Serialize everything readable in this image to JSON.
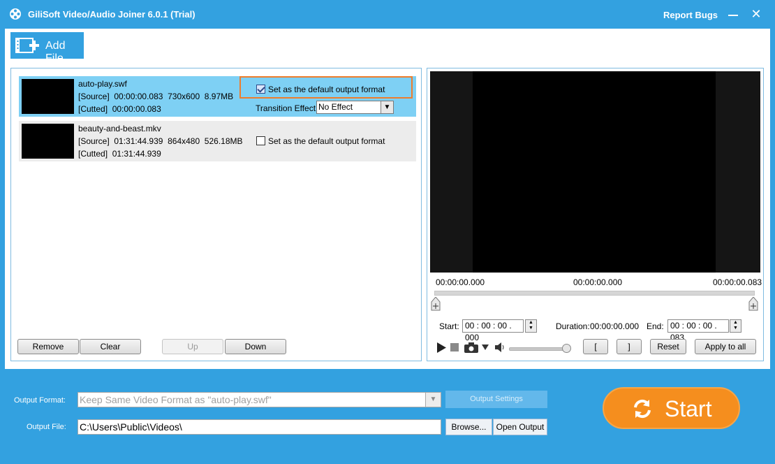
{
  "window": {
    "title": "GiliSoft Video/Audio Joiner 6.0.1 (Trial)",
    "report_bugs": "Report Bugs",
    "accent_color": "#33a1e0"
  },
  "toolbar": {
    "add_file_label": "Add File"
  },
  "file_list": {
    "items": [
      {
        "name": "auto-play.swf",
        "source": "[Source]  00:00:00.083  730x600  8.97MB",
        "cutted": "[Cutted]  00:00:00.083",
        "default_format_label": "Set as the default output format",
        "default_format_checked": true,
        "transition_label": "Transition Effect:",
        "transition_value": "No Effect",
        "selected": true
      },
      {
        "name": "beauty-and-beast.mkv",
        "source": "[Source]  01:31:44.939  864x480  526.18MB",
        "cutted": "[Cutted]  01:31:44.939",
        "default_format_label": "Set as the default output format",
        "default_format_checked": false,
        "selected": false
      }
    ],
    "buttons": {
      "remove": "Remove",
      "clear": "Clear",
      "up": "Up",
      "down": "Down"
    }
  },
  "preview": {
    "time_left": "00:00:00.000",
    "time_middle": "00:00:00.000",
    "time_right": "00:00:00.083",
    "start_label": "Start:",
    "start_value": "00 : 00 : 00 . 000",
    "duration_label": "Duration:",
    "duration_value": "00:00:00.000",
    "end_label": "End:",
    "end_value": "00 : 00 : 00 . 083",
    "mark_in": "[",
    "mark_out": "]",
    "reset": "Reset",
    "apply_to_all": "Apply to all"
  },
  "output": {
    "format_label": "Output Format:",
    "format_value": "Keep Same Video Format as \"auto-play.swf\"",
    "settings_button": "Output Settings",
    "file_label": "Output File:",
    "file_value": "C:\\Users\\Public\\Videos\\",
    "browse_button": "Browse...",
    "open_output_button": "Open Output",
    "start_button": "Start",
    "start_color": "#f58e1e"
  }
}
